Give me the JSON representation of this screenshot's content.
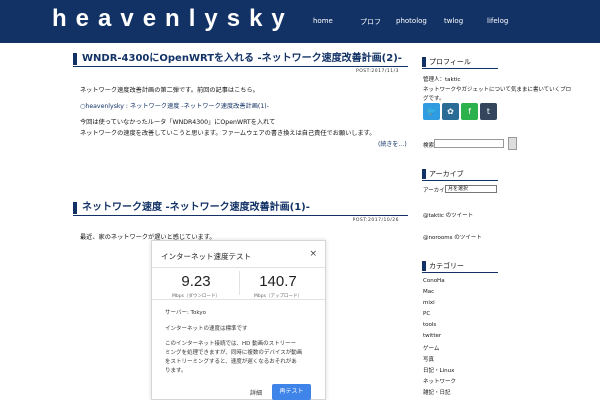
{
  "header": {
    "site_title": "heavenlysky",
    "nav": [
      "home",
      "プロフ",
      "photolog",
      "twlog",
      "lifelog"
    ]
  },
  "posts": [
    {
      "title": "WNDR-4300にOpenWRTを入れる -ネットワーク速度改善計画(2)-",
      "date": "POST:2017/11/3",
      "lines": [
        "ネットワーク速度改善計画の第二弾です。前回の記事はこちら。",
        "○heavenlysky : ネットワーク速度 -ネットワーク速度改善計画(1)-",
        "今回は使っていなかったルータ「WNDR4300」にOpenWRTを入れて",
        "ネットワークの速度を改善していこうと思います。ファームウェアの書き換えは自己責任でお願いします。"
      ],
      "read_more": "(続きを…)"
    },
    {
      "title": "ネットワーク速度 -ネットワーク速度改善計画(1)-",
      "date": "POST:2017/10/26",
      "lines": [
        "最近、家のネットワークが遅いと感じています。"
      ]
    }
  ],
  "speedtest": {
    "title": "インターネット速度テスト",
    "close": "×",
    "download_value": "9.23",
    "download_unit": "Mbps（ダウンロード）",
    "upload_value": "140.7",
    "upload_unit": "Mbps（アップロード）",
    "server": "サーバー: Tokyo",
    "status": "インターネットの速度は標準です",
    "desc": [
      "このインターネット接続では、HD 動画のストリーー",
      "ミングを処理できますが、同時に複数のデバイスが動画",
      "をストリーミングすると、速度が遅くなるおそれがあ",
      "ります。"
    ],
    "details": "詳細",
    "retest": "再テスト"
  },
  "sidebar": {
    "profile_head": "プロフィール",
    "profile_lines": [
      "管理人：taktic",
      "ネットワークやガジェットについて気ままに書いていくブロ",
      "グです。"
    ],
    "sns_icons": [
      {
        "name": "twitter-icon",
        "glyph": "🐦",
        "color": "#2f9be0"
      },
      {
        "name": "flickr-icon",
        "glyph": "✿",
        "color": "#2a6c96"
      },
      {
        "name": "feedly-icon",
        "glyph": "f",
        "color": "#2bb24c"
      },
      {
        "name": "tumblr-icon",
        "glyph": "t",
        "color": "#35465c"
      }
    ],
    "search_label": "検索:",
    "archive_head": "アーカイブ",
    "archive_label": "アーカイブ",
    "archive_select": "月を選択",
    "twitter_lines": [
      "@taktic のツイート",
      "@norooms のツイート"
    ],
    "category_head": "カテゴリー",
    "categories": [
      "ConoHa",
      "Mac",
      "mixi",
      "PC",
      "tools",
      "twitter",
      "ゲーム",
      "写真",
      "日記・Linux",
      "ネットワーク",
      "雑記・日記"
    ]
  }
}
